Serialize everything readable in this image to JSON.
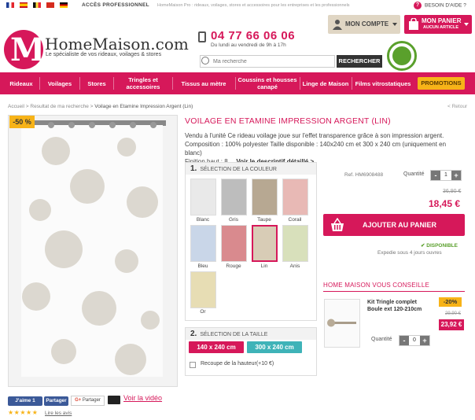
{
  "topbar": {
    "pro_label": "ACCÈS PROFESSIONNEL",
    "description": "HomeMaison Pro : rideaux, voilages, stores et accessoires pour les entreprises et les professionnels",
    "help_label": "BESOIN D'AIDE ?"
  },
  "header": {
    "brand": "HomeMaison.com",
    "tagline": "Le spécialiste de vos rideaux, voilages & stores",
    "phone": "04 77 66 06 06",
    "hours": "Du lundi au vendredi de 9h à 17h",
    "search_placeholder": "Ma recherche",
    "search_button": "RECHERCHER",
    "account_label": "MON COMPTE",
    "cart_label": "MON PANIER",
    "cart_sub": "AUCUN ARTICLE"
  },
  "nav": {
    "items": [
      "Rideaux",
      "Voilages",
      "Stores",
      "Tringles et accessoires",
      "Tissus au mètre",
      "Coussins et housses canapé",
      "Linge de Maison",
      "Films vitrostatiques"
    ],
    "promo": "PROMOTIONS"
  },
  "breadcrumb": {
    "home": "Accueil",
    "search": "Resultat de ma recherche",
    "current": "Voilage en Etamine Impression Argent (Lin)",
    "sep": ">",
    "back": "< Retour"
  },
  "product": {
    "discount": "-50 %",
    "title": "VOILAGE EN ETAMINE IMPRESSION ARGENT (LIN)",
    "desc_line1": "Vendu à l'unité   Ce rideau voilage joue sur l'effet transparence grâce à son impression argent.",
    "desc_line2": "Composition : 100% polyester Taille disponible : 140x240 cm et 300 x 240 cm (uniquement en blanc)",
    "desc_line3": "Finition haut : 8...",
    "desc_link": "Voir le descriptif détaillé >",
    "ref": "Ref. HM6908488",
    "qty_label": "Quantité",
    "qty_value": "1",
    "old_price": "36,90 €",
    "new_price": "18,45 €",
    "add_to_cart": "AJOUTER AU PANIER",
    "stock": "✔ DISPONIBLE",
    "shipping": "Expedie sous 4 jours ouvres"
  },
  "colors": {
    "num": "1.",
    "title": "SÉLECTION DE LA COULEUR",
    "options": [
      "Blanc",
      "Gris",
      "Taupe",
      "Corail",
      "Bleu",
      "Rouge",
      "Lin",
      "Anis",
      "Or"
    ],
    "swatch_colors": [
      "#e9e9e9",
      "#bdbdbd",
      "#b7a892",
      "#e8b9b5",
      "#c9d6e8",
      "#d98a8e",
      "#d8ccb6",
      "#d8e0bb",
      "#e7ddb4"
    ]
  },
  "sizes": {
    "num": "2.",
    "title": "SÉLECTION DE LA TAILLE",
    "options": [
      "140 x 240 cm",
      "300 x 240 cm"
    ],
    "recut": "Recoupe de la hauteur(+10 €)"
  },
  "recommend": {
    "title": "HOME MAISON VOUS CONSEILLE",
    "item_title": "Kit Tringle complet Boule ext 120-210cm",
    "discount": "-20%",
    "old_price": "29,90 €",
    "new_price": "23,92 €",
    "qty_label": "Quantité",
    "qty_value": "0"
  },
  "social": {
    "like": "J'aime 1",
    "share": "Partager",
    "gplus_share": "Partager",
    "video": "Voir la vidéo",
    "stars": "★★★★★",
    "reviews": "Lire les avis"
  },
  "theme": {
    "accent": "#d6185a",
    "promo": "#f7b318",
    "size2": "#3fb3b8"
  }
}
